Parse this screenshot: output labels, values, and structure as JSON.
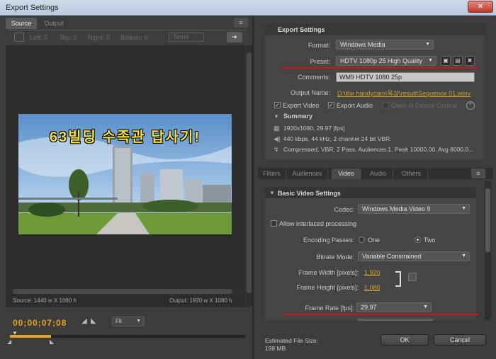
{
  "window": {
    "title": "Export Settings",
    "close_label": "✕"
  },
  "left": {
    "tabs": {
      "source": "Source",
      "output": "Output"
    },
    "menu_icon": "≡",
    "crop": {
      "left": "Left:  0",
      "top": "Top:  0",
      "right": "Right:  0",
      "bottom": "Bottom:  0",
      "ratio": "None"
    },
    "video_overlay_text": "63빌딩  수족관  답사기!",
    "source_dims": "Source: 1440 w X 1080 h",
    "output_dims": "Output: 1920 w X 1080 h",
    "timecode": "00;00;07;08",
    "mark_in_icon": "◢",
    "mark_out_icon": "◣",
    "zoom": "Fit",
    "playhead_icon": "▼",
    "in_icon": "◢",
    "out_icon": "◣"
  },
  "export_settings": {
    "title": "Export Settings",
    "format_label": "Format:",
    "format_value": "Windows Media",
    "preset_label": "Preset:",
    "preset_value": "HDTV 1080p 25 High Quality",
    "comments_label": "Comments:",
    "comments_value": "WM9 HDTV 1080 25p",
    "output_name_label": "Output Name:",
    "output_name_value": "D:\\the handycam\\육상\\result\\Sequence 01.wmv",
    "export_video": "Export Video",
    "export_audio": "Export Audio",
    "open_device": "Open in Device Central",
    "summary_title": "Summary",
    "summary_lines": [
      "1920x1080, 29.97 [fps]",
      "440 kbps, 44 kHz, 2 channel 24 bit VBR",
      "Compressed, VBR, 2 Pass, Audiences:1, Peak 10000.00, Avg 8000.0..."
    ]
  },
  "tabs": [
    "Filters",
    "Audiences",
    "Video",
    "Audio",
    "Others"
  ],
  "basic_video": {
    "title": "Basic Video Settings",
    "codec_label": "Codec:",
    "codec_value": "Windows Media Video 9",
    "interlaced_label": "Allow interlaced processing",
    "passes_label": "Encoding Passes:",
    "pass_one": "One",
    "pass_two": "Two",
    "bitrate_label": "Bitrate Mode:",
    "bitrate_value": "Variable Constrained",
    "frame_width_label": "Frame Width [pixels]:",
    "frame_width_value": "1,920",
    "frame_height_label": "Frame Height [pixels]:",
    "frame_height_value": "1,080",
    "frame_rate_label": "Frame Rate [fps]:",
    "frame_rate_value": "29.97"
  },
  "footer": {
    "est_label": "Estimated File Size:",
    "est_value": "198 MB",
    "ok": "OK",
    "cancel": "Cancel"
  },
  "colors": {
    "accent_orange": "#e0a12c",
    "highlight_red": "#d11414"
  }
}
